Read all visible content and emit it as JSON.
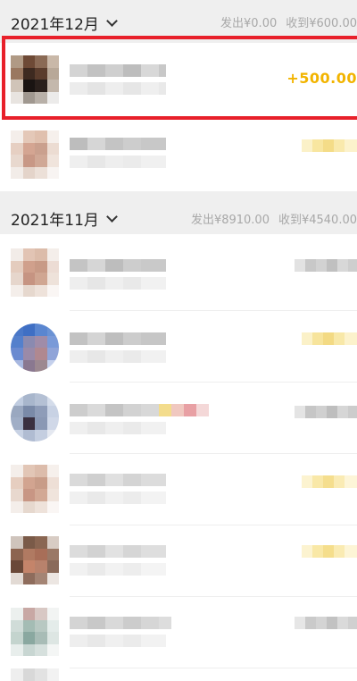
{
  "months": [
    {
      "title": "2021年12月",
      "sent": "发出¥0.00",
      "received": "收到¥600.00"
    },
    {
      "title": "2021年11月",
      "sent": "发出¥8910.00",
      "received": "收到¥4540.00"
    }
  ],
  "highlighted_transaction": {
    "amount": "+500.00"
  },
  "colors": {
    "accent_amount": "#f2b400",
    "highlight_border": "#e8202a",
    "header_bg": "#efefef",
    "summary_text": "#a8a8a8"
  }
}
